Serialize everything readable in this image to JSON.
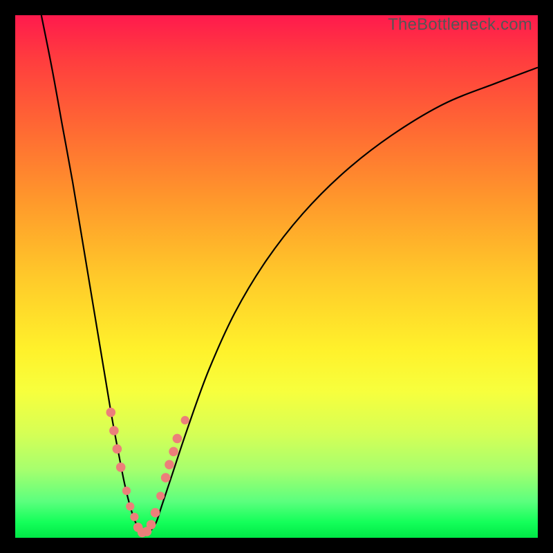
{
  "watermark": "TheBottleneck.com",
  "colors": {
    "gradient_top": "#ff1a4d",
    "gradient_mid": "#fff12b",
    "gradient_bottom": "#00e846",
    "curve": "#000000",
    "marker": "#ec7f7a",
    "frame": "#000000"
  },
  "chart_data": {
    "type": "line",
    "title": "",
    "xlabel": "",
    "ylabel": "",
    "xlim": [
      0,
      100
    ],
    "ylim": [
      0,
      100
    ],
    "grid": false,
    "legend": false,
    "note": "No visible axis ticks or labels. x in percent of width (0=left), y in percent of height with 0 at bottom, 100 at top. Curve estimated from pixels.",
    "series": [
      {
        "name": "bottleneck-curve",
        "x": [
          5,
          7,
          9,
          11,
          13,
          15,
          17,
          18.5,
          20,
          21,
          22,
          23,
          24,
          25,
          26,
          27,
          28,
          30,
          33,
          37,
          42,
          48,
          55,
          63,
          72,
          82,
          92,
          100
        ],
        "y": [
          100,
          90,
          79,
          68,
          56,
          44,
          32,
          23,
          15,
          10,
          6,
          3,
          1.5,
          1,
          1.5,
          3,
          6,
          12,
          21,
          32,
          43,
          53,
          62,
          70,
          77,
          83,
          87,
          90
        ]
      }
    ],
    "markers": {
      "name": "highlighted-points",
      "note": "salmon dots clustered near the curve trough, approximate pixel-read positions",
      "points": [
        {
          "x": 18.3,
          "y": 24.0,
          "r": 1.0
        },
        {
          "x": 18.9,
          "y": 20.5,
          "r": 1.0
        },
        {
          "x": 19.5,
          "y": 17.0,
          "r": 1.0
        },
        {
          "x": 20.2,
          "y": 13.5,
          "r": 1.0
        },
        {
          "x": 21.3,
          "y": 9.0,
          "r": 0.9
        },
        {
          "x": 22.0,
          "y": 6.0,
          "r": 0.9
        },
        {
          "x": 22.8,
          "y": 4.0,
          "r": 0.9
        },
        {
          "x": 23.5,
          "y": 2.0,
          "r": 1.0
        },
        {
          "x": 24.3,
          "y": 1.0,
          "r": 1.0
        },
        {
          "x": 25.2,
          "y": 1.2,
          "r": 1.0
        },
        {
          "x": 26.0,
          "y": 2.5,
          "r": 1.0
        },
        {
          "x": 26.8,
          "y": 4.8,
          "r": 1.0
        },
        {
          "x": 27.8,
          "y": 8.0,
          "r": 0.9
        },
        {
          "x": 28.8,
          "y": 11.5,
          "r": 1.0
        },
        {
          "x": 29.5,
          "y": 14.0,
          "r": 1.0
        },
        {
          "x": 30.3,
          "y": 16.5,
          "r": 1.0
        },
        {
          "x": 31.0,
          "y": 19.0,
          "r": 1.0
        },
        {
          "x": 32.5,
          "y": 22.5,
          "r": 0.9
        }
      ]
    }
  }
}
